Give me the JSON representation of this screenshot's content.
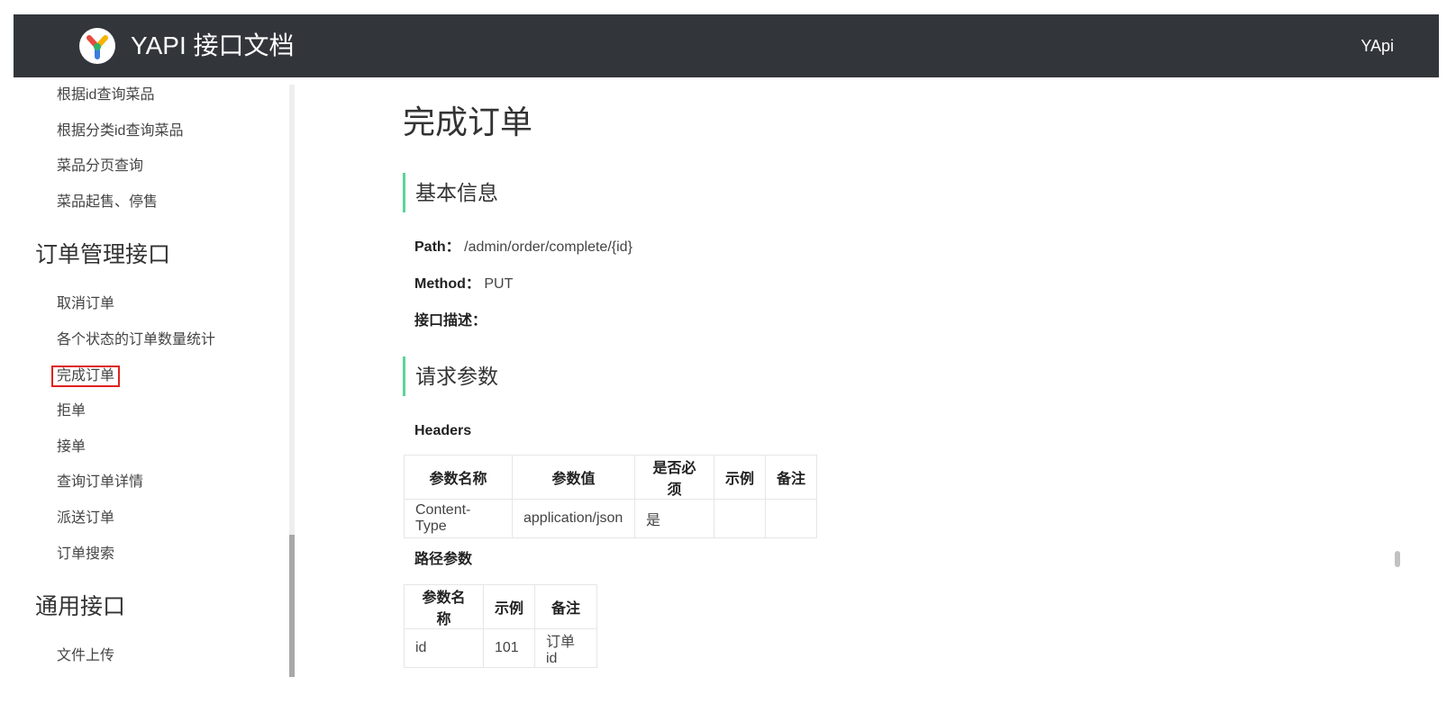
{
  "header": {
    "title": "YAPI 接口文档",
    "right_label": "YApi"
  },
  "sidebar": {
    "items_top": [
      "根据id查询菜品",
      "根据分类id查询菜品",
      "菜品分页查询",
      "菜品起售、停售"
    ],
    "group_order": "订单管理接口",
    "items_order": [
      "取消订单",
      "各个状态的订单数量统计",
      "完成订单",
      "拒单",
      "接单",
      "查询订单详情",
      "派送订单",
      "订单搜索"
    ],
    "group_common": "通用接口",
    "items_common": [
      "文件上传"
    ]
  },
  "main": {
    "page_title": "完成订单",
    "basic_info": {
      "heading": "基本信息",
      "path_label": "Path：",
      "path_value": "/admin/order/complete/{id}",
      "method_label": "Method：",
      "method_value": "PUT",
      "desc_label": "接口描述："
    },
    "request": {
      "heading": "请求参数",
      "headers_title": "Headers",
      "headers_table": {
        "columns": [
          "参数名称",
          "参数值",
          "是否必须",
          "示例",
          "备注"
        ],
        "rows": [
          [
            "Content-Type",
            "application/json",
            "是",
            "",
            ""
          ]
        ]
      },
      "path_params_title": "路径参数",
      "path_table": {
        "columns": [
          "参数名称",
          "示例",
          "备注"
        ],
        "rows": [
          [
            "id",
            "101",
            "订单id"
          ]
        ]
      }
    }
  },
  "colors": {
    "header_bg": "#32363a",
    "section_accent": "#59d49a",
    "active_border": "#e0211f"
  }
}
